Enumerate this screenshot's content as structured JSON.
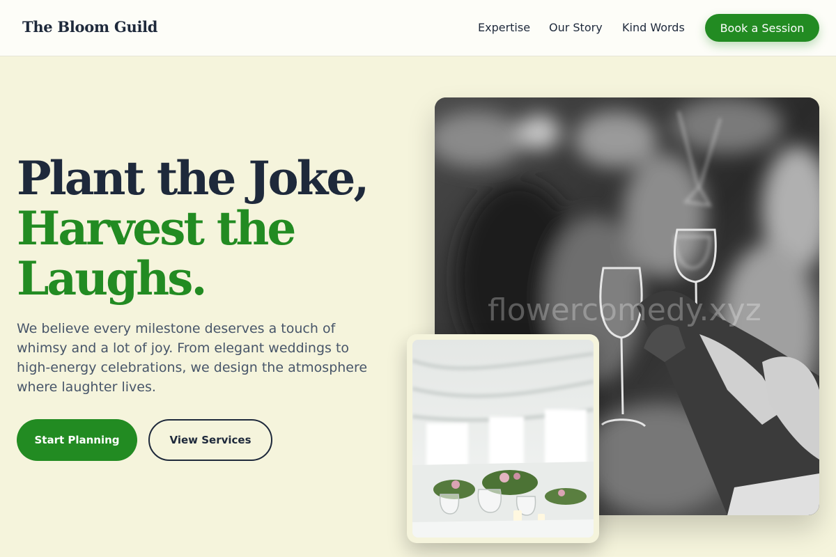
{
  "nav": {
    "logo": "The Bloom Guild",
    "links": [
      "Expertise",
      "Our Story",
      "Kind Words"
    ],
    "cta": "Book a Session"
  },
  "hero": {
    "headline_line1": "Plant the Joke,",
    "headline_line2": "Harvest the",
    "headline_line3": "Laughs.",
    "intro": "We believe every milestone deserves a touch of whimsy and a lot of joy. From elegant weddings to high-energy celebrations, we design the atmosphere where laughter lives.",
    "primary_button": "Start Planning",
    "secondary_button": "View Services"
  },
  "watermark": "flowercomedy.xyz",
  "colors": {
    "accent": "#228b22",
    "heading": "#1e293b",
    "background": "#f5f4dc"
  }
}
